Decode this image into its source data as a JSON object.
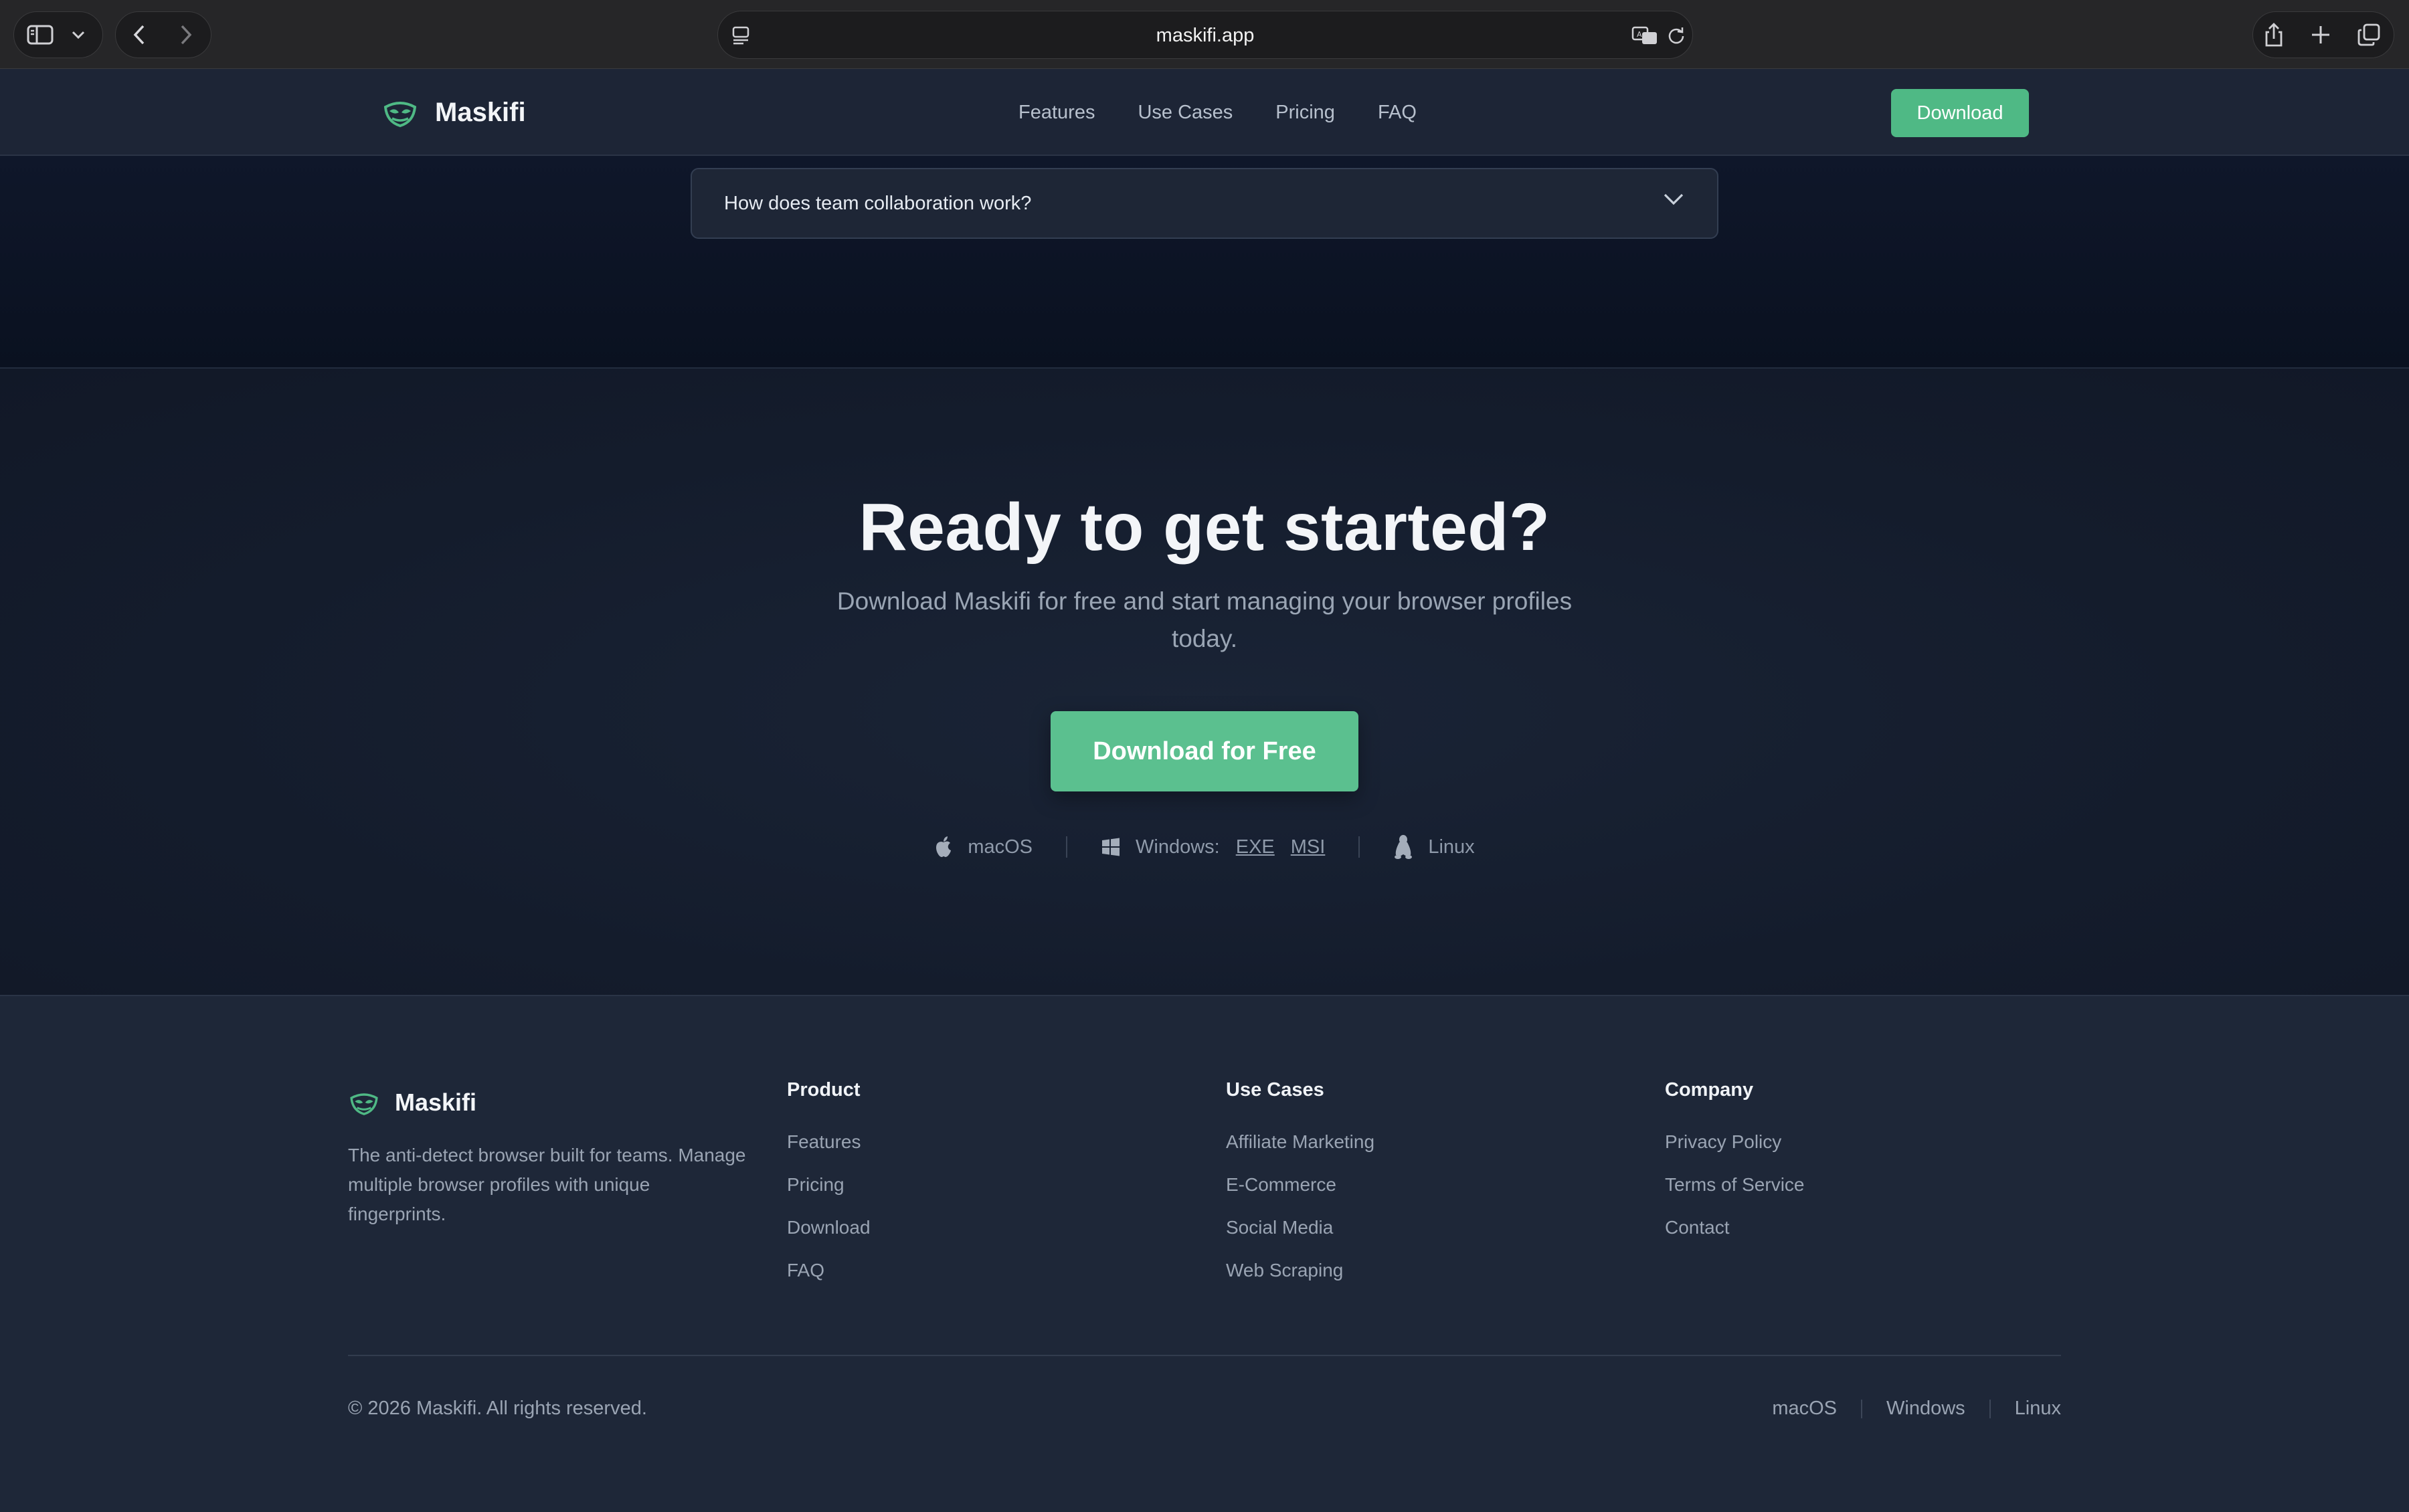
{
  "browser": {
    "url": "maskifi.app"
  },
  "nav": {
    "brand": "Maskifi",
    "links": [
      "Features",
      "Use Cases",
      "Pricing",
      "FAQ"
    ],
    "download_label": "Download"
  },
  "faq": {
    "question": "How does team collaboration work?"
  },
  "cta": {
    "title": "Ready to get started?",
    "subtitle": "Download Maskifi for free and start managing your browser profiles today.",
    "button_label": "Download for Free",
    "macos_label": "macOS",
    "windows_label": "Windows:",
    "exe_label": "EXE",
    "msi_label": "MSI",
    "linux_label": "Linux"
  },
  "footer": {
    "brand": "Maskifi",
    "description": "The anti-detect browser built for teams. Manage multiple browser profiles with unique fingerprints.",
    "columns": [
      {
        "title": "Product",
        "links": [
          "Features",
          "Pricing",
          "Download",
          "FAQ"
        ]
      },
      {
        "title": "Use Cases",
        "links": [
          "Affiliate Marketing",
          "E-Commerce",
          "Social Media",
          "Web Scraping"
        ]
      },
      {
        "title": "Company",
        "links": [
          "Privacy Policy",
          "Terms of Service",
          "Contact"
        ]
      }
    ],
    "copyright": "© 2026 Maskifi. All rights reserved.",
    "platforms": [
      "macOS",
      "Windows",
      "Linux"
    ]
  },
  "colors": {
    "accent": "#4fb985",
    "cta_button": "#5bc08f",
    "nav_bg": "#1d2536",
    "footer_bg": "#1e2738"
  }
}
